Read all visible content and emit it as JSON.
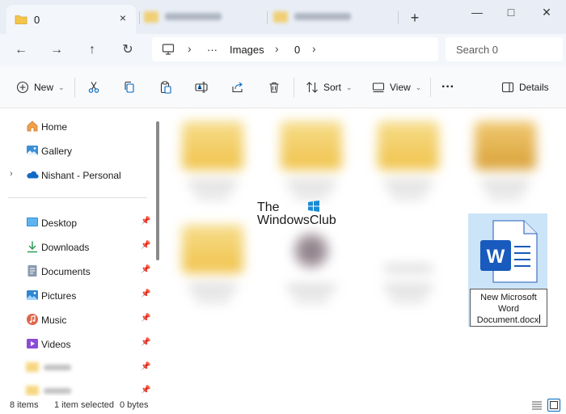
{
  "window": {
    "active_tab_title": "0",
    "tab_close_glyph": "×",
    "new_tab_glyph": "+",
    "minimize_glyph": "—",
    "maximize_glyph": "□",
    "close_glyph": "✕"
  },
  "navigation": {
    "back_glyph": "←",
    "forward_glyph": "→",
    "up_glyph": "↑",
    "refresh_glyph": "↻",
    "breadcrumb_overflow": "···",
    "breadcrumb": [
      "Images",
      "0"
    ],
    "chevron_glyph": "›",
    "search_placeholder": "Search 0"
  },
  "toolbar": {
    "new_label": "New",
    "sort_label": "Sort",
    "view_label": "View",
    "more_glyph": "···",
    "details_label": "Details",
    "dropdown_glyph": "⌄"
  },
  "sidebar": {
    "expand_glyph": "›",
    "pin_glyph": "📌",
    "quick": [
      {
        "label": "Home",
        "icon": "home-icon"
      },
      {
        "label": "Gallery",
        "icon": "gallery-icon"
      },
      {
        "label": "Nishant - Personal",
        "icon": "onedrive-icon"
      }
    ],
    "pinned": [
      {
        "label": "Desktop",
        "icon": "desktop-icon"
      },
      {
        "label": "Downloads",
        "icon": "downloads-icon"
      },
      {
        "label": "Documents",
        "icon": "documents-icon"
      },
      {
        "label": "Pictures",
        "icon": "pictures-icon"
      },
      {
        "label": "Music",
        "icon": "music-icon"
      },
      {
        "label": "Videos",
        "icon": "videos-icon"
      }
    ]
  },
  "content": {
    "watermark_line1": "The",
    "watermark_line2": "WindowsClub",
    "selected_file": {
      "name_line1": "New Microsoft",
      "name_line2": "Word",
      "name_line3": "Document.docx",
      "icon": "word-document-icon"
    }
  },
  "status": {
    "items_count": "8 items",
    "selection": "1 item selected",
    "size": "0 bytes"
  },
  "colors": {
    "selection": "#cce4f7",
    "folder": "#f3c54b",
    "accent": "#0067c0",
    "word_blue": "#185abd"
  }
}
